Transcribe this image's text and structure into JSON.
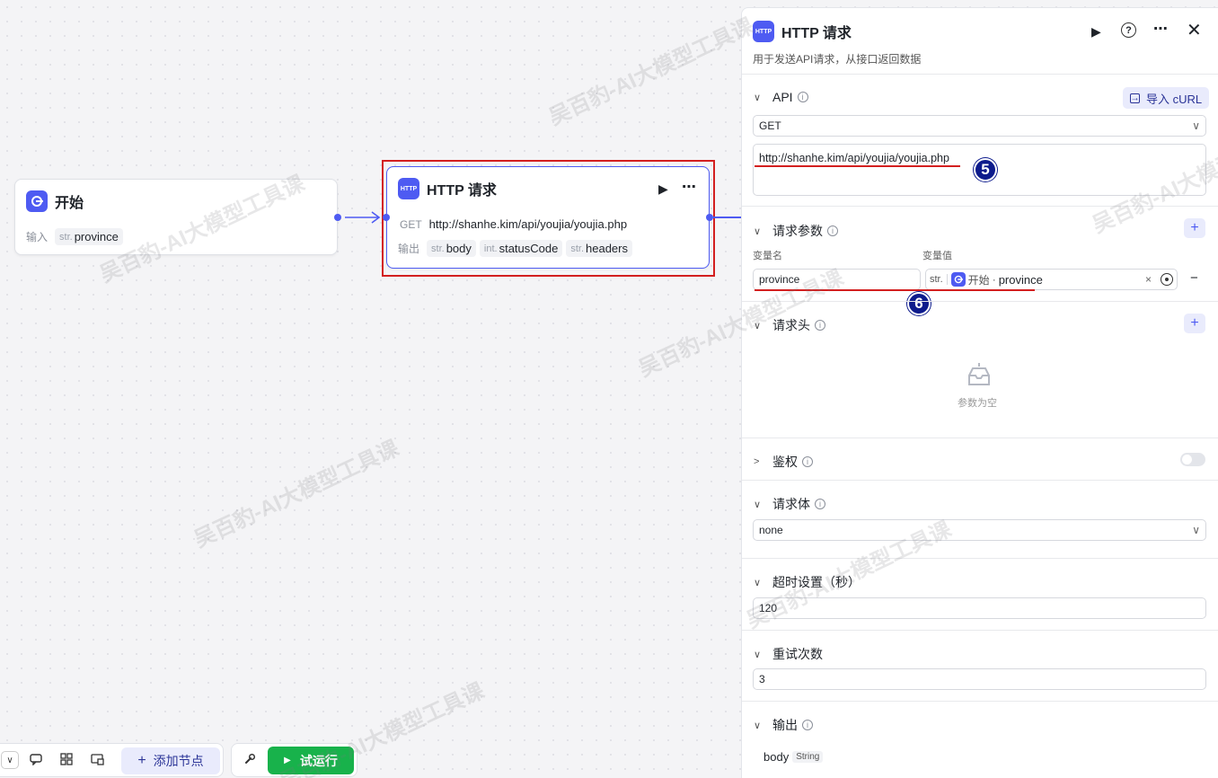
{
  "watermark": "吴百豹-AI大模型工具课",
  "start_node": {
    "title": "开始",
    "input_label": "输入",
    "input_type": "str.",
    "input_name": "province"
  },
  "http_node": {
    "title": "HTTP 请求",
    "method": "GET",
    "url": "http://shanhe.kim/api/youjia/youjia.php",
    "output_label": "输出",
    "outputs": [
      {
        "type": "str.",
        "name": "body"
      },
      {
        "type": "int.",
        "name": "statusCode"
      },
      {
        "type": "str.",
        "name": "headers"
      }
    ]
  },
  "panel": {
    "title": "HTTP 请求",
    "description": "用于发送API请求，从接口返回数据",
    "api": {
      "label": "API",
      "import_label": "导入 cURL",
      "method": "GET",
      "url": "http://shanhe.kim/api/youjia/youjia.php"
    },
    "params": {
      "label": "请求参数",
      "col_name": "变量名",
      "col_value": "变量值",
      "row": {
        "name": "province",
        "type": "str.",
        "ref_node": "开始",
        "ref_sep": "·",
        "ref_var": "province",
        "clear": "×",
        "remove": "−"
      }
    },
    "headers": {
      "label": "请求头",
      "empty": "参数为空"
    },
    "auth": {
      "label": "鉴权",
      "enabled": false
    },
    "body": {
      "label": "请求体",
      "value": "none"
    },
    "timeout": {
      "label": "超时设置（秒）",
      "value": "120"
    },
    "retry": {
      "label": "重试次数",
      "value": "3"
    },
    "output": {
      "label": "输出",
      "name": "body",
      "type": "String"
    }
  },
  "annotations": {
    "five": "5",
    "six": "6"
  },
  "toolbar": {
    "add_node": "添加节点",
    "test_run": "试运行"
  },
  "colors": {
    "accent": "#4e5bf2",
    "run": "#18b24b",
    "highlight": "#d31f1f"
  }
}
